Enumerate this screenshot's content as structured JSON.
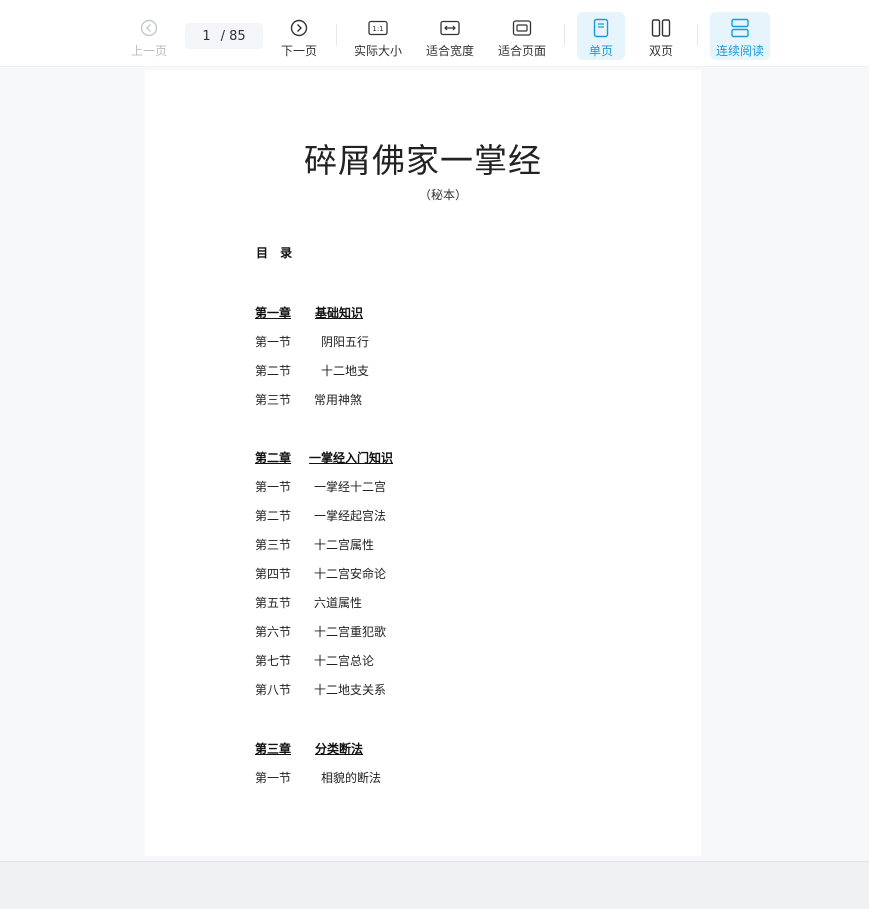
{
  "toolbar": {
    "prev_label": "上一页",
    "next_label": "下一页",
    "current_page": "1",
    "total_pages": "/ 85",
    "actual_size_label": "实际大小",
    "fit_width_label": "适合宽度",
    "fit_page_label": "适合页面",
    "single_page_label": "单页",
    "double_page_label": "双页",
    "continuous_label": "连续阅读",
    "icons": {
      "prev": "chevron-left-circle-icon",
      "next": "chevron-right-circle-icon",
      "actual_size": "actual-size-icon",
      "fit_width": "fit-width-icon",
      "fit_page": "fit-page-icon",
      "single_page": "single-page-icon",
      "double_page": "double-page-icon",
      "continuous": "continuous-reading-icon"
    },
    "accent_color": "#1a9bd7"
  },
  "document": {
    "title": "碎屑佛家一掌经",
    "subtitle": "（秘本）",
    "toc_heading": "目 录",
    "chapters": [
      {
        "num": "第一章",
        "title": "基础知识",
        "sections": [
          {
            "num": "第一节",
            "title": "阴阳五行"
          },
          {
            "num": "第二节",
            "title": "十二地支"
          },
          {
            "num": "第三节",
            "title": "常用神煞"
          }
        ]
      },
      {
        "num": "第二章",
        "title": "一掌经入门知识",
        "sections": [
          {
            "num": "第一节",
            "title": "一掌经十二宫"
          },
          {
            "num": "第二节",
            "title": "一掌经起宫法"
          },
          {
            "num": "第三节",
            "title": "十二宫属性"
          },
          {
            "num": "第四节",
            "title": "十二宫安命论"
          },
          {
            "num": "第五节",
            "title": "六道属性"
          },
          {
            "num": "第六节",
            "title": "十二宫重犯歌"
          },
          {
            "num": "第七节",
            "title": "十二宫总论"
          },
          {
            "num": "第八节",
            "title": "十二地支关系"
          }
        ]
      },
      {
        "num": "第三章",
        "title": "分类断法",
        "sections": [
          {
            "num": "第一节",
            "title": "相貌的断法"
          }
        ]
      }
    ]
  }
}
